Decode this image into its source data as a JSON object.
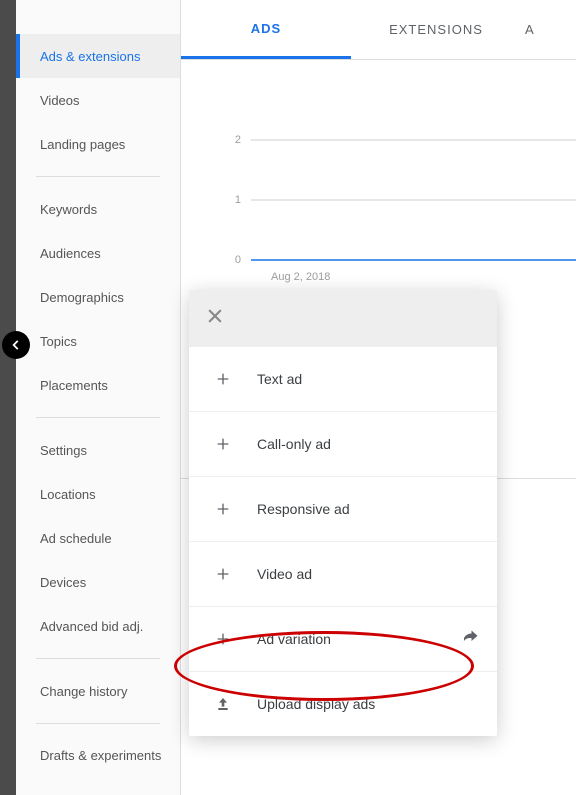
{
  "sidebar": {
    "items": [
      {
        "label": "Ads & extensions"
      },
      {
        "label": "Videos"
      },
      {
        "label": "Landing pages"
      },
      {
        "label": "Keywords"
      },
      {
        "label": "Audiences"
      },
      {
        "label": "Demographics"
      },
      {
        "label": "Topics"
      },
      {
        "label": "Placements"
      },
      {
        "label": "Settings"
      },
      {
        "label": "Locations"
      },
      {
        "label": "Ad schedule"
      },
      {
        "label": "Devices"
      },
      {
        "label": "Advanced bid adj."
      },
      {
        "label": "Change history"
      },
      {
        "label": "Drafts & experiments"
      }
    ]
  },
  "tabs": [
    {
      "label": "ADS"
    },
    {
      "label": "EXTENSIONS"
    },
    {
      "label": "A"
    }
  ],
  "chart_data": {
    "type": "line",
    "ylim": [
      0,
      2
    ],
    "yticks": [
      0,
      1,
      2
    ],
    "x_label_visible": "Aug 2, 2018",
    "values": [
      0,
      0,
      0,
      0,
      0,
      0,
      0
    ]
  },
  "menu": {
    "items": [
      {
        "label": "Text ad"
      },
      {
        "label": "Call-only ad"
      },
      {
        "label": "Responsive ad"
      },
      {
        "label": "Video ad"
      },
      {
        "label": "Ad variation"
      },
      {
        "label": "Upload display ads"
      }
    ]
  }
}
